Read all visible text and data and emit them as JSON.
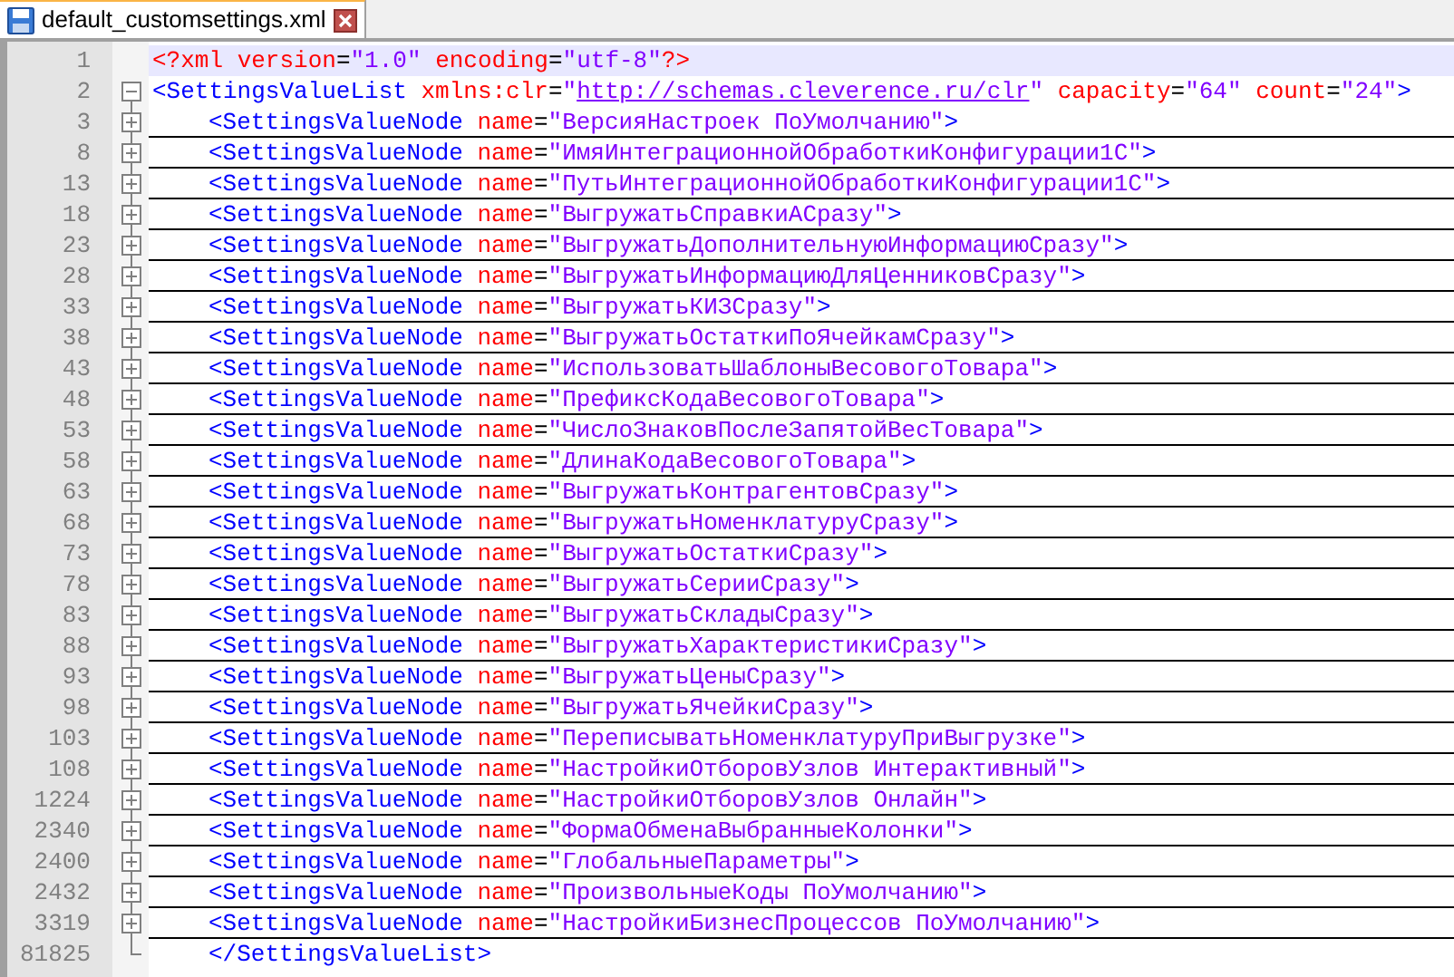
{
  "tab": {
    "title": "default_customsettings.xml",
    "selected": true
  },
  "lines": [
    {
      "number": "1",
      "current": true,
      "tokens": [
        {
          "kind": "decl",
          "text": "<?xml"
        },
        {
          "kind": "attr",
          "text": " version"
        },
        {
          "kind": "eq",
          "text": "="
        },
        {
          "kind": "value",
          "text": "\"1.0\""
        },
        {
          "kind": "attr",
          "text": " encoding"
        },
        {
          "kind": "eq",
          "text": "="
        },
        {
          "kind": "value",
          "text": "\"utf-8\""
        },
        {
          "kind": "decl",
          "text": "?>"
        }
      ]
    },
    {
      "number": "2",
      "current": false,
      "expanded": true,
      "tokens": [
        {
          "kind": "tag",
          "text": "<SettingsValueList"
        },
        {
          "kind": "attr",
          "text": " xmlns:clr"
        },
        {
          "kind": "eq",
          "text": "="
        },
        {
          "kind": "value",
          "text": "\""
        },
        {
          "kind": "link",
          "text": "http://schemas.cleverence.ru/clr"
        },
        {
          "kind": "value",
          "text": "\""
        },
        {
          "kind": "attr",
          "text": " capacity"
        },
        {
          "kind": "eq",
          "text": "="
        },
        {
          "kind": "value",
          "text": "\"64\""
        },
        {
          "kind": "attr",
          "text": " count"
        },
        {
          "kind": "eq",
          "text": "="
        },
        {
          "kind": "value",
          "text": "\"24\""
        },
        {
          "kind": "tag",
          "text": ">"
        }
      ],
      "children": [
        {
          "number": "3",
          "current": false,
          "expanded": false,
          "tokens": [
            {
              "kind": "tag",
              "text": "<SettingsValueNode"
            },
            {
              "kind": "attr",
              "text": " name"
            },
            {
              "kind": "eq",
              "text": "="
            },
            {
              "kind": "value",
              "text": "\"ВерсияНастроек ПоУмолчанию\""
            },
            {
              "kind": "tag",
              "text": ">"
            }
          ]
        },
        {
          "number": "8",
          "current": false,
          "expanded": false,
          "tokens": [
            {
              "kind": "tag",
              "text": "<SettingsValueNode"
            },
            {
              "kind": "attr",
              "text": " name"
            },
            {
              "kind": "eq",
              "text": "="
            },
            {
              "kind": "value",
              "text": "\"ИмяИнтеграционнойОбработкиКонфигурации1С\""
            },
            {
              "kind": "tag",
              "text": ">"
            }
          ]
        },
        {
          "number": "13",
          "current": false,
          "expanded": false,
          "tokens": [
            {
              "kind": "tag",
              "text": "<SettingsValueNode"
            },
            {
              "kind": "attr",
              "text": " name"
            },
            {
              "kind": "eq",
              "text": "="
            },
            {
              "kind": "value",
              "text": "\"ПутьИнтеграционнойОбработкиКонфигурации1С\""
            },
            {
              "kind": "tag",
              "text": ">"
            }
          ]
        },
        {
          "number": "18",
          "current": false,
          "expanded": false,
          "tokens": [
            {
              "kind": "tag",
              "text": "<SettingsValueNode"
            },
            {
              "kind": "attr",
              "text": " name"
            },
            {
              "kind": "eq",
              "text": "="
            },
            {
              "kind": "value",
              "text": "\"ВыгружатьСправкиАСразу\""
            },
            {
              "kind": "tag",
              "text": ">"
            }
          ]
        },
        {
          "number": "23",
          "current": false,
          "expanded": false,
          "tokens": [
            {
              "kind": "tag",
              "text": "<SettingsValueNode"
            },
            {
              "kind": "attr",
              "text": " name"
            },
            {
              "kind": "eq",
              "text": "="
            },
            {
              "kind": "value",
              "text": "\"ВыгружатьДополнительнуюИнформациюСразу\""
            },
            {
              "kind": "tag",
              "text": ">"
            }
          ]
        },
        {
          "number": "28",
          "current": false,
          "expanded": false,
          "tokens": [
            {
              "kind": "tag",
              "text": "<SettingsValueNode"
            },
            {
              "kind": "attr",
              "text": " name"
            },
            {
              "kind": "eq",
              "text": "="
            },
            {
              "kind": "value",
              "text": "\"ВыгружатьИнформациюДляЦенниковСразу\""
            },
            {
              "kind": "tag",
              "text": ">"
            }
          ]
        },
        {
          "number": "33",
          "current": false,
          "expanded": false,
          "tokens": [
            {
              "kind": "tag",
              "text": "<SettingsValueNode"
            },
            {
              "kind": "attr",
              "text": " name"
            },
            {
              "kind": "eq",
              "text": "="
            },
            {
              "kind": "value",
              "text": "\"ВыгружатьКИЗСразу\""
            },
            {
              "kind": "tag",
              "text": ">"
            }
          ]
        },
        {
          "number": "38",
          "current": false,
          "expanded": false,
          "tokens": [
            {
              "kind": "tag",
              "text": "<SettingsValueNode"
            },
            {
              "kind": "attr",
              "text": " name"
            },
            {
              "kind": "eq",
              "text": "="
            },
            {
              "kind": "value",
              "text": "\"ВыгружатьОстаткиПоЯчейкамСразу\""
            },
            {
              "kind": "tag",
              "text": ">"
            }
          ]
        },
        {
          "number": "43",
          "current": false,
          "expanded": false,
          "tokens": [
            {
              "kind": "tag",
              "text": "<SettingsValueNode"
            },
            {
              "kind": "attr",
              "text": " name"
            },
            {
              "kind": "eq",
              "text": "="
            },
            {
              "kind": "value",
              "text": "\"ИспользоватьШаблоныВесовогоТовара\""
            },
            {
              "kind": "tag",
              "text": ">"
            }
          ]
        },
        {
          "number": "48",
          "current": false,
          "expanded": false,
          "tokens": [
            {
              "kind": "tag",
              "text": "<SettingsValueNode"
            },
            {
              "kind": "attr",
              "text": " name"
            },
            {
              "kind": "eq",
              "text": "="
            },
            {
              "kind": "value",
              "text": "\"ПрефиксКодаВесовогоТовара\""
            },
            {
              "kind": "tag",
              "text": ">"
            }
          ]
        },
        {
          "number": "53",
          "current": false,
          "expanded": false,
          "tokens": [
            {
              "kind": "tag",
              "text": "<SettingsValueNode"
            },
            {
              "kind": "attr",
              "text": " name"
            },
            {
              "kind": "eq",
              "text": "="
            },
            {
              "kind": "value",
              "text": "\"ЧислоЗнаковПослеЗапятойВесТовара\""
            },
            {
              "kind": "tag",
              "text": ">"
            }
          ]
        },
        {
          "number": "58",
          "current": false,
          "expanded": false,
          "tokens": [
            {
              "kind": "tag",
              "text": "<SettingsValueNode"
            },
            {
              "kind": "attr",
              "text": " name"
            },
            {
              "kind": "eq",
              "text": "="
            },
            {
              "kind": "value",
              "text": "\"ДлинаКодаВесовогоТовара\""
            },
            {
              "kind": "tag",
              "text": ">"
            }
          ]
        },
        {
          "number": "63",
          "current": false,
          "expanded": false,
          "tokens": [
            {
              "kind": "tag",
              "text": "<SettingsValueNode"
            },
            {
              "kind": "attr",
              "text": " name"
            },
            {
              "kind": "eq",
              "text": "="
            },
            {
              "kind": "value",
              "text": "\"ВыгружатьКонтрагентовСразу\""
            },
            {
              "kind": "tag",
              "text": ">"
            }
          ]
        },
        {
          "number": "68",
          "current": false,
          "expanded": false,
          "tokens": [
            {
              "kind": "tag",
              "text": "<SettingsValueNode"
            },
            {
              "kind": "attr",
              "text": " name"
            },
            {
              "kind": "eq",
              "text": "="
            },
            {
              "kind": "value",
              "text": "\"ВыгружатьНоменклатуруСразу\""
            },
            {
              "kind": "tag",
              "text": ">"
            }
          ]
        },
        {
          "number": "73",
          "current": false,
          "expanded": false,
          "tokens": [
            {
              "kind": "tag",
              "text": "<SettingsValueNode"
            },
            {
              "kind": "attr",
              "text": " name"
            },
            {
              "kind": "eq",
              "text": "="
            },
            {
              "kind": "value",
              "text": "\"ВыгружатьОстаткиСразу\""
            },
            {
              "kind": "tag",
              "text": ">"
            }
          ]
        },
        {
          "number": "78",
          "current": false,
          "expanded": false,
          "tokens": [
            {
              "kind": "tag",
              "text": "<SettingsValueNode"
            },
            {
              "kind": "attr",
              "text": " name"
            },
            {
              "kind": "eq",
              "text": "="
            },
            {
              "kind": "value",
              "text": "\"ВыгружатьСерииСразу\""
            },
            {
              "kind": "tag",
              "text": ">"
            }
          ]
        },
        {
          "number": "83",
          "current": false,
          "expanded": false,
          "tokens": [
            {
              "kind": "tag",
              "text": "<SettingsValueNode"
            },
            {
              "kind": "attr",
              "text": " name"
            },
            {
              "kind": "eq",
              "text": "="
            },
            {
              "kind": "value",
              "text": "\"ВыгружатьСкладыСразу\""
            },
            {
              "kind": "tag",
              "text": ">"
            }
          ]
        },
        {
          "number": "88",
          "current": false,
          "expanded": false,
          "tokens": [
            {
              "kind": "tag",
              "text": "<SettingsValueNode"
            },
            {
              "kind": "attr",
              "text": " name"
            },
            {
              "kind": "eq",
              "text": "="
            },
            {
              "kind": "value",
              "text": "\"ВыгружатьХарактеристикиСразу\""
            },
            {
              "kind": "tag",
              "text": ">"
            }
          ]
        },
        {
          "number": "93",
          "current": false,
          "expanded": false,
          "tokens": [
            {
              "kind": "tag",
              "text": "<SettingsValueNode"
            },
            {
              "kind": "attr",
              "text": " name"
            },
            {
              "kind": "eq",
              "text": "="
            },
            {
              "kind": "value",
              "text": "\"ВыгружатьЦеныСразу\""
            },
            {
              "kind": "tag",
              "text": ">"
            }
          ]
        },
        {
          "number": "98",
          "current": false,
          "expanded": false,
          "tokens": [
            {
              "kind": "tag",
              "text": "<SettingsValueNode"
            },
            {
              "kind": "attr",
              "text": " name"
            },
            {
              "kind": "eq",
              "text": "="
            },
            {
              "kind": "value",
              "text": "\"ВыгружатьЯчейкиСразу\""
            },
            {
              "kind": "tag",
              "text": ">"
            }
          ]
        },
        {
          "number": "103",
          "current": false,
          "expanded": false,
          "tokens": [
            {
              "kind": "tag",
              "text": "<SettingsValueNode"
            },
            {
              "kind": "attr",
              "text": " name"
            },
            {
              "kind": "eq",
              "text": "="
            },
            {
              "kind": "value",
              "text": "\"ПереписыватьНоменклатуруПриВыгрузке\""
            },
            {
              "kind": "tag",
              "text": ">"
            }
          ]
        },
        {
          "number": "108",
          "current": false,
          "expanded": false,
          "tokens": [
            {
              "kind": "tag",
              "text": "<SettingsValueNode"
            },
            {
              "kind": "attr",
              "text": " name"
            },
            {
              "kind": "eq",
              "text": "="
            },
            {
              "kind": "value",
              "text": "\"НастройкиОтборовУзлов Интерактивный\""
            },
            {
              "kind": "tag",
              "text": ">"
            }
          ]
        },
        {
          "number": "1224",
          "current": false,
          "expanded": false,
          "tokens": [
            {
              "kind": "tag",
              "text": "<SettingsValueNode"
            },
            {
              "kind": "attr",
              "text": " name"
            },
            {
              "kind": "eq",
              "text": "="
            },
            {
              "kind": "value",
              "text": "\"НастройкиОтборовУзлов Онлайн\""
            },
            {
              "kind": "tag",
              "text": ">"
            }
          ]
        },
        {
          "number": "2340",
          "current": false,
          "expanded": false,
          "tokens": [
            {
              "kind": "tag",
              "text": "<SettingsValueNode"
            },
            {
              "kind": "attr",
              "text": " name"
            },
            {
              "kind": "eq",
              "text": "="
            },
            {
              "kind": "value",
              "text": "\"ФормаОбменаВыбранныеКолонки\""
            },
            {
              "kind": "tag",
              "text": ">"
            }
          ]
        },
        {
          "number": "2400",
          "current": false,
          "expanded": false,
          "tokens": [
            {
              "kind": "tag",
              "text": "<SettingsValueNode"
            },
            {
              "kind": "attr",
              "text": " name"
            },
            {
              "kind": "eq",
              "text": "="
            },
            {
              "kind": "value",
              "text": "\"ГлобальныеПараметры\""
            },
            {
              "kind": "tag",
              "text": ">"
            }
          ]
        },
        {
          "number": "2432",
          "current": false,
          "expanded": false,
          "tokens": [
            {
              "kind": "tag",
              "text": "<SettingsValueNode"
            },
            {
              "kind": "attr",
              "text": " name"
            },
            {
              "kind": "eq",
              "text": "="
            },
            {
              "kind": "value",
              "text": "\"ПроизвольныеКоды ПоУмолчанию\""
            },
            {
              "kind": "tag",
              "text": ">"
            }
          ]
        },
        {
          "number": "3319",
          "current": false,
          "expanded": false,
          "tokens": [
            {
              "kind": "tag",
              "text": "<SettingsValueNode"
            },
            {
              "kind": "attr",
              "text": " name"
            },
            {
              "kind": "eq",
              "text": "="
            },
            {
              "kind": "value",
              "text": "\"НастройкиБизнесПроцессов ПоУмолчанию\""
            },
            {
              "kind": "tag",
              "text": ">"
            }
          ]
        },
        {
          "number": "81825",
          "current": false,
          "tokens": [
            {
              "kind": "tag",
              "text": "</SettingsValueList>"
            }
          ]
        }
      ]
    }
  ]
}
